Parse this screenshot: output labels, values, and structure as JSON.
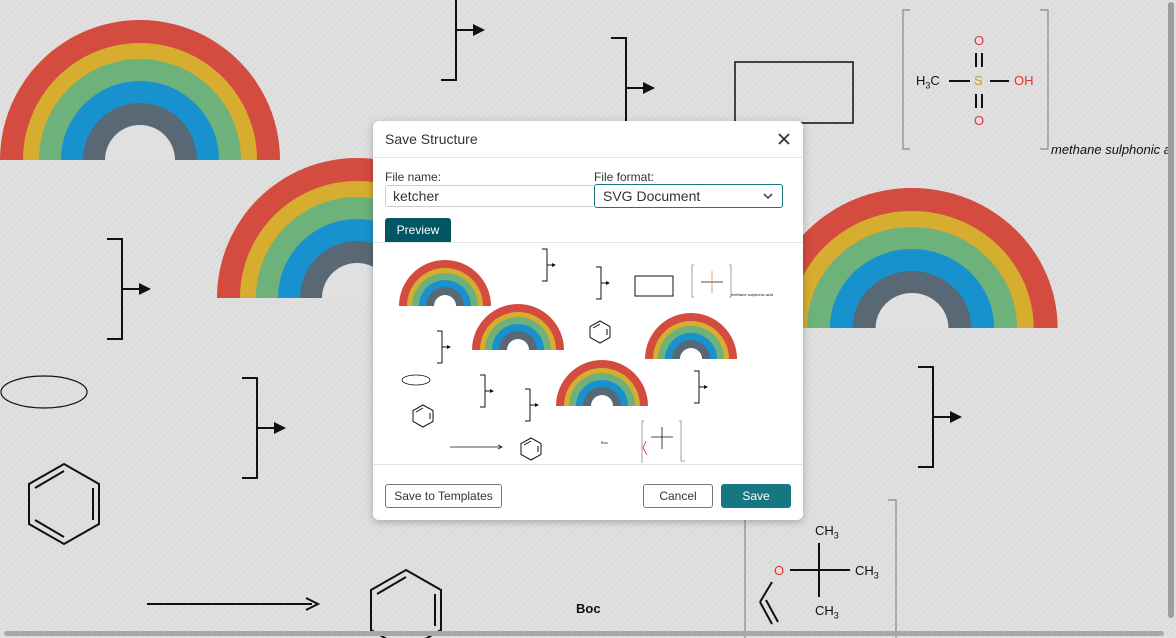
{
  "canvas": {
    "labels": {
      "methane_caption": "methane sulphonic a",
      "boc": "Boc"
    },
    "molecule_methane": {
      "h3c": "H",
      "h3c_sub": "3",
      "h3c_c": "C",
      "s": "S",
      "oh": "OH",
      "o_top": "O",
      "o_bottom": "O"
    },
    "molecule_boc": {
      "ch3": "CH",
      "sub": "3",
      "o": "O"
    }
  },
  "dialog": {
    "title": "Save Structure",
    "file_name_label": "File name:",
    "file_name_value": "ketcher",
    "file_format_label": "File format:",
    "file_format_value": "SVG Document",
    "tab_preview": "Preview",
    "preview_caption": "methane sulphonic acid",
    "preview_boc": "Boc",
    "save_to_templates": "Save to Templates",
    "cancel": "Cancel",
    "save": "Save"
  },
  "colors": {
    "rainbow": [
      "#d44b3f",
      "#d6ad2e",
      "#6db27a",
      "#1891cf",
      "#586874"
    ],
    "accent": "#167782",
    "tab_active": "#005662",
    "hetero_red": "#e5322d",
    "sulfur": "#c39b2d"
  }
}
